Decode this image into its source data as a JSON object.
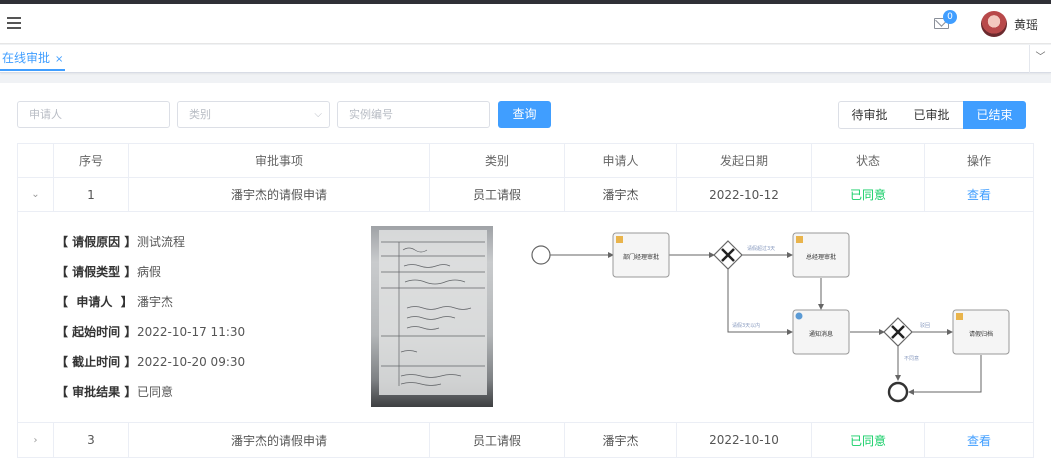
{
  "header": {
    "mail_badge": "0",
    "user_name": "黄瑶"
  },
  "tabs": [
    {
      "label": "在线审批",
      "close": "×"
    }
  ],
  "filters": {
    "applicant_placeholder": "申请人",
    "category_placeholder": "类别",
    "instance_placeholder": "实例编号",
    "query_label": "查询"
  },
  "status_tabs": [
    {
      "label": "待审批",
      "active": false
    },
    {
      "label": "已审批",
      "active": false
    },
    {
      "label": "已结束",
      "active": true
    }
  ],
  "table": {
    "columns": [
      "序号",
      "审批事项",
      "类别",
      "申请人",
      "发起日期",
      "状态",
      "操作"
    ],
    "rows": [
      {
        "index": "1",
        "item": "潘宇杰的请假申请",
        "category": "员工请假",
        "applicant": "潘宇杰",
        "date": "2022-10-12",
        "status": "已同意",
        "action": "查看",
        "expanded": true
      },
      {
        "index": "3",
        "item": "潘宇杰的请假申请",
        "category": "员工请假",
        "applicant": "潘宇杰",
        "date": "2022-10-10",
        "status": "已同意",
        "action": "查看",
        "expanded": false
      }
    ]
  },
  "detail": {
    "fields": [
      {
        "key": "【 请假原因 】",
        "value": "测试流程"
      },
      {
        "key": "【 请假类型 】",
        "value": "病假"
      },
      {
        "key": "【  申请人  】",
        "value": "潘宇杰"
      },
      {
        "key": "【 起始时间 】",
        "value": "2022-10-17 11:30"
      },
      {
        "key": "【 截止时间 】",
        "value": "2022-10-20 09:30"
      },
      {
        "key": "【 审批结果 】",
        "value": "已同意"
      }
    ]
  },
  "flow": {
    "tasks": [
      "部门经理审批",
      "总经理审批",
      "通知消息",
      "请假归档"
    ],
    "edge_labels": [
      "请假超过3天",
      "请假3天以内",
      "驳回",
      "不同意"
    ]
  },
  "colors": {
    "accent": "#409eff",
    "success": "#13ce66"
  }
}
